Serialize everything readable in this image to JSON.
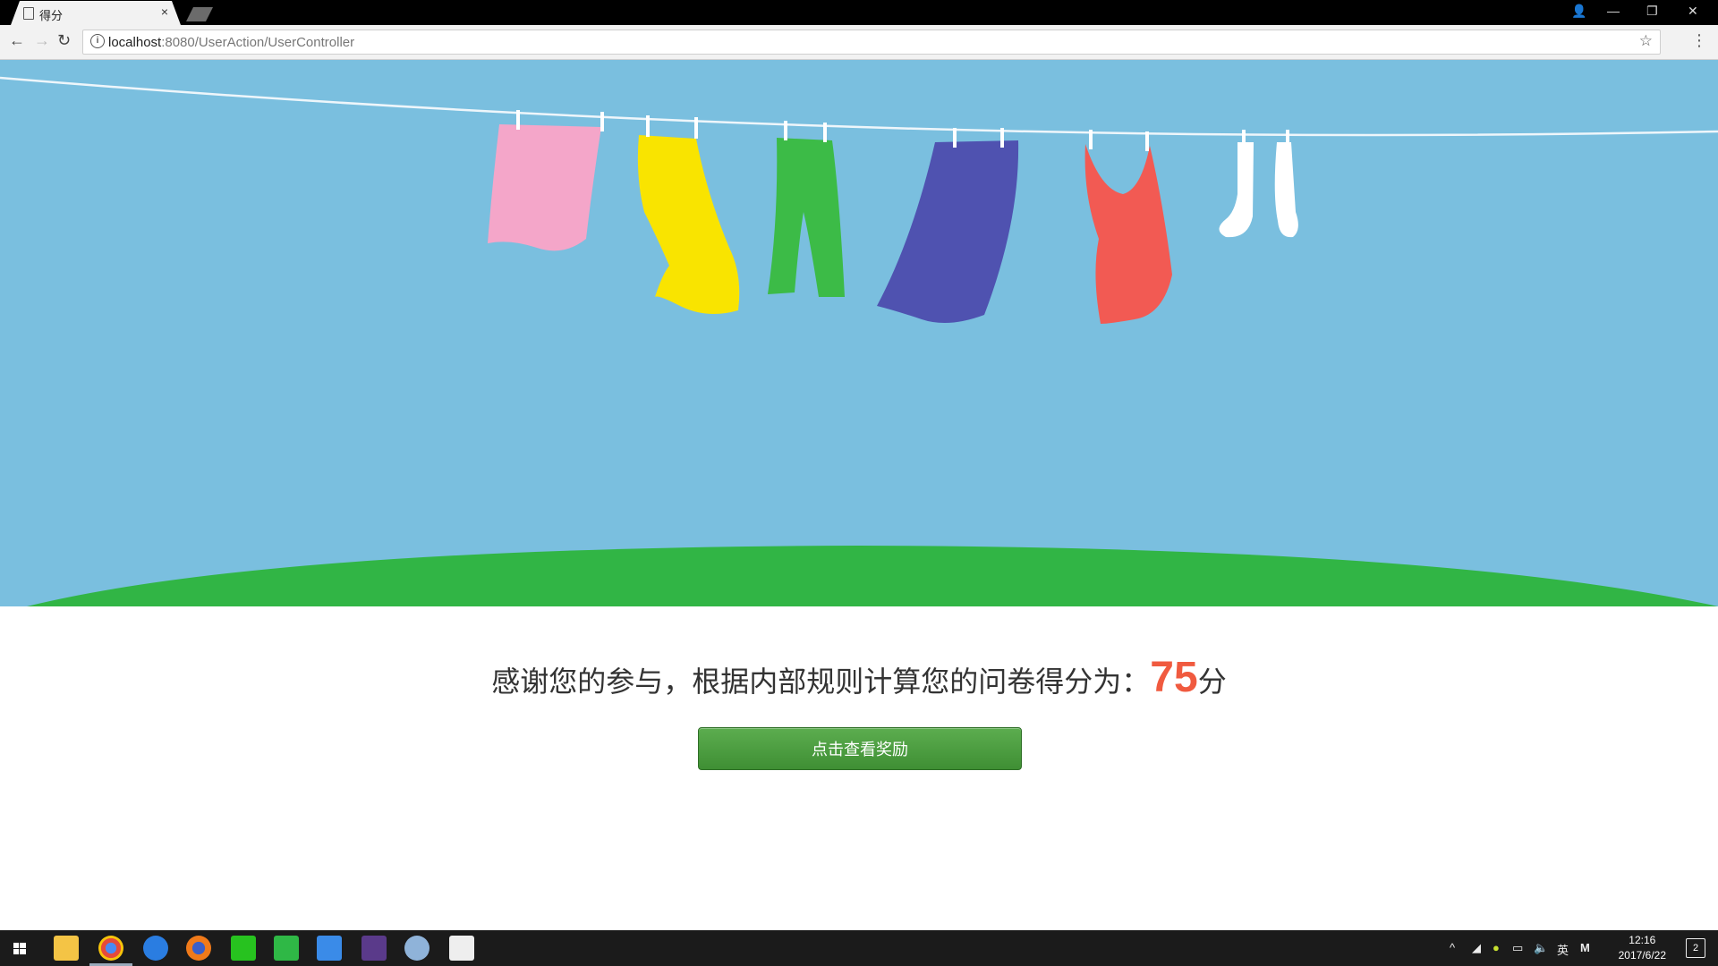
{
  "browser": {
    "tab_title": "得分",
    "tab_close": "×",
    "url_host": "localhost",
    "url_path": ":8080/UserAction/UserController",
    "info_glyph": "i",
    "star_glyph": "☆",
    "menu_glyph": "⋮",
    "back_glyph": "←",
    "forward_glyph": "→",
    "reload_glyph": "↻"
  },
  "window_controls": {
    "user": "👤",
    "minimize": "—",
    "restore": "❐",
    "close": "✕"
  },
  "page": {
    "message": "感谢您的参与，根据内部规则计算您的问卷得分为：",
    "score": "75",
    "unit": "分",
    "reward_button": "点击查看奖励"
  },
  "taskbar": {
    "apps": [
      "start-icon",
      "file-explorer-icon",
      "chrome-icon",
      "sogou-icon",
      "firefox-icon",
      "iqiyi-icon",
      "evernote-icon",
      "feishu-icon",
      "game-icon",
      "paint-icon",
      "photos-icon"
    ],
    "tray": {
      "ime": "英",
      "m_icon": "M"
    },
    "time": "12:16",
    "date": "2017/6/22",
    "notifications": "2"
  },
  "colors": {
    "sky": "#7abfdf",
    "grass": "#31b545",
    "score": "#f05a3f",
    "button": "#4a9a3e"
  }
}
